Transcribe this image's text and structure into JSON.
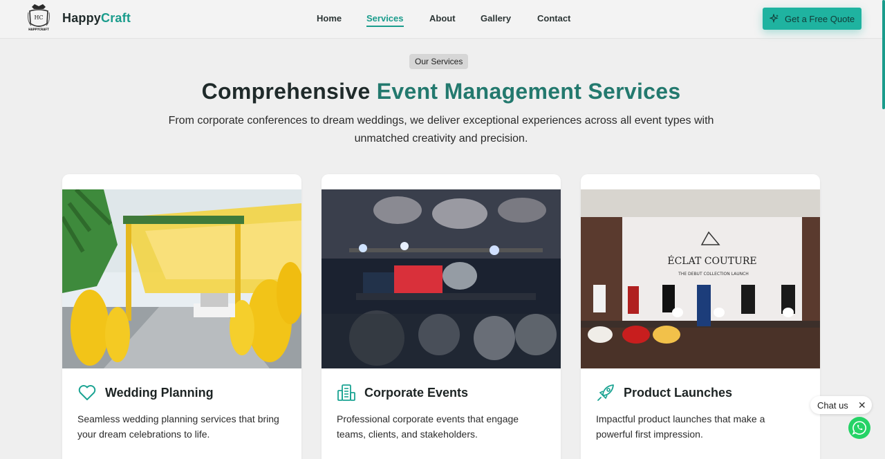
{
  "header": {
    "logo_text": "HC",
    "logo_caption": "HAPPYCRAFT",
    "brand_part1": "Happy",
    "brand_part2": "Craft",
    "nav": [
      {
        "label": "Home"
      },
      {
        "label": "Services",
        "active": true
      },
      {
        "label": "About"
      },
      {
        "label": "Gallery"
      },
      {
        "label": "Contact"
      }
    ],
    "cta_label": "Get a Free Quote",
    "cta_icon": "sparkles-icon"
  },
  "section": {
    "badge": "Our Services",
    "title_part1": "Comprehensive",
    "title_part2": "Event Management Services",
    "subtitle": "From corporate conferences to dream weddings, we deliver exceptional experiences across all event types with unmatched creativity and precision."
  },
  "cards": [
    {
      "title": "Wedding Planning",
      "icon": "heart-icon",
      "description": "Seamless wedding planning services that bring your dream celebrations to life."
    },
    {
      "title": "Corporate Events",
      "icon": "building-icon",
      "description": "Professional corporate events that engage teams, clients, and stakeholders."
    },
    {
      "title": "Product Launches",
      "icon": "rocket-icon",
      "description": "Impactful product launches that make a powerful first impression.",
      "image_sign_title": "ÉCLAT COUTURE",
      "image_sign_sub": "THE DEBUT COLLECTION LAUNCH"
    }
  ],
  "chat": {
    "label": "Chat us",
    "close_icon": "close-icon",
    "whatsapp_icon": "whatsapp-icon"
  },
  "colors": {
    "accent": "#1a9c8c",
    "cta_bg": "#1fb3a0",
    "title_accent": "#23796e",
    "page_bg": "#efefef"
  }
}
